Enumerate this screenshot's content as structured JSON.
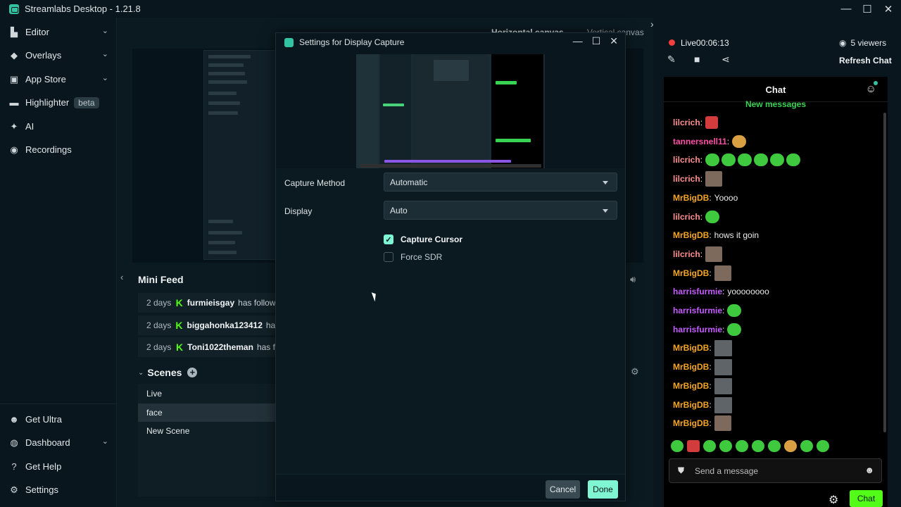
{
  "app": {
    "title": "Streamlabs Desktop - 1.21.8"
  },
  "window_controls": [
    "—",
    "☐",
    "✕"
  ],
  "sidebar": {
    "items": [
      {
        "label": "Editor",
        "icon": "editor-icon",
        "has_chevron": true
      },
      {
        "label": "Overlays",
        "icon": "overlays-icon",
        "has_chevron": true
      },
      {
        "label": "App Store",
        "icon": "app-store-icon",
        "has_chevron": true
      },
      {
        "label": "Highlighter",
        "icon": "highlighter-icon",
        "badge": "beta"
      },
      {
        "label": "AI",
        "icon": "ai-sparkle-icon"
      },
      {
        "label": "Recordings",
        "icon": "recordings-icon"
      }
    ],
    "bottom_items": [
      {
        "label": "Get Ultra",
        "icon": "ultra-icon"
      },
      {
        "label": "Dashboard",
        "icon": "dashboard-icon",
        "has_chevron": true
      },
      {
        "label": "Get Help",
        "icon": "help-icon"
      },
      {
        "label": "Settings",
        "icon": "settings-gear-icon"
      }
    ]
  },
  "preview": {
    "canvas_horizontal": "Horizontal canvas",
    "canvas_vertical": "Vertical canvas"
  },
  "minifeed": {
    "title": "Mini Feed",
    "rows": [
      {
        "age": "2 days",
        "user": "furmieisgay",
        "action": "has follow"
      },
      {
        "age": "2 days",
        "user": "biggahonka123412",
        "action": "ha"
      },
      {
        "age": "2 days",
        "user": "Toni1022theman",
        "action": "has f"
      }
    ]
  },
  "scenes": {
    "title": "Scenes",
    "items": [
      "Live",
      "face",
      "New Scene"
    ],
    "active_index": 1
  },
  "stream": {
    "live_label": "Live",
    "timer": "00:06:13",
    "viewers": "5 viewers",
    "refresh_chat": "Refresh Chat"
  },
  "chat": {
    "title": "Chat",
    "new_messages": "New messages",
    "messages": [
      {
        "name": "lilcrich",
        "color": "#ff8f8f",
        "text": "",
        "emotes": [
          "red"
        ]
      },
      {
        "name": "tannersnell11",
        "color": "#ff4fa8",
        "text": "",
        "emotes": [
          "burger"
        ]
      },
      {
        "name": "lilcrich",
        "color": "#ff8f8f",
        "text": "",
        "emotes": [
          "green",
          "green",
          "green",
          "green",
          "green",
          "green"
        ]
      },
      {
        "name": "lilcrich",
        "color": "#ff8f8f",
        "text": "",
        "emotes": [
          "photo"
        ]
      },
      {
        "name": "MrBigDB",
        "color": "#f5a623",
        "text": "Yoooo",
        "emotes": []
      },
      {
        "name": "lilcrich",
        "color": "#ff8f8f",
        "text": "",
        "emotes": [
          "green"
        ]
      },
      {
        "name": "MrBigDB",
        "color": "#f5a623",
        "text": "hows it goin",
        "emotes": []
      },
      {
        "name": "lilcrich",
        "color": "#ff8f8f",
        "text": "",
        "emotes": [
          "photo"
        ]
      },
      {
        "name": "MrBigDB",
        "color": "#f5a623",
        "text": "",
        "emotes": [
          "photo"
        ]
      },
      {
        "name": "harrisfurmie",
        "color": "#c45cff",
        "text": "yoooooooo",
        "emotes": []
      },
      {
        "name": "harrisfurmie",
        "color": "#c45cff",
        "text": "",
        "emotes": [
          "green"
        ]
      },
      {
        "name": "harrisfurmie",
        "color": "#c45cff",
        "text": "",
        "emotes": [
          "green"
        ]
      },
      {
        "name": "MrBigDB",
        "color": "#f5a623",
        "text": "",
        "emotes": [
          "gray"
        ]
      },
      {
        "name": "MrBigDB",
        "color": "#f5a623",
        "text": "",
        "emotes": [
          "gray"
        ]
      },
      {
        "name": "MrBigDB",
        "color": "#f5a623",
        "text": "",
        "emotes": [
          "gray"
        ]
      },
      {
        "name": "MrBigDB",
        "color": "#f5a623",
        "text": "",
        "emotes": [
          "gray"
        ]
      },
      {
        "name": "MrBigDB",
        "color": "#f5a623",
        "text": "",
        "emotes": [
          "photo"
        ]
      }
    ],
    "emote_bar": [
      "green",
      "red",
      "green",
      "green",
      "green",
      "green",
      "green",
      "burger",
      "green",
      "green"
    ],
    "send_placeholder": "Send a message",
    "send_button": "Chat"
  },
  "modal": {
    "title": "Settings for Display Capture",
    "capture_method_label": "Capture Method",
    "capture_method_value": "Automatic",
    "display_label": "Display",
    "display_value": "Auto",
    "capture_cursor_label": "Capture Cursor",
    "capture_cursor_checked": true,
    "force_sdr_label": "Force SDR",
    "force_sdr_checked": false,
    "cancel_label": "Cancel",
    "done_label": "Done"
  },
  "colors": {
    "accent": "#80f5d2",
    "kick_green": "#53fc18",
    "live_red": "#f43f3f"
  }
}
